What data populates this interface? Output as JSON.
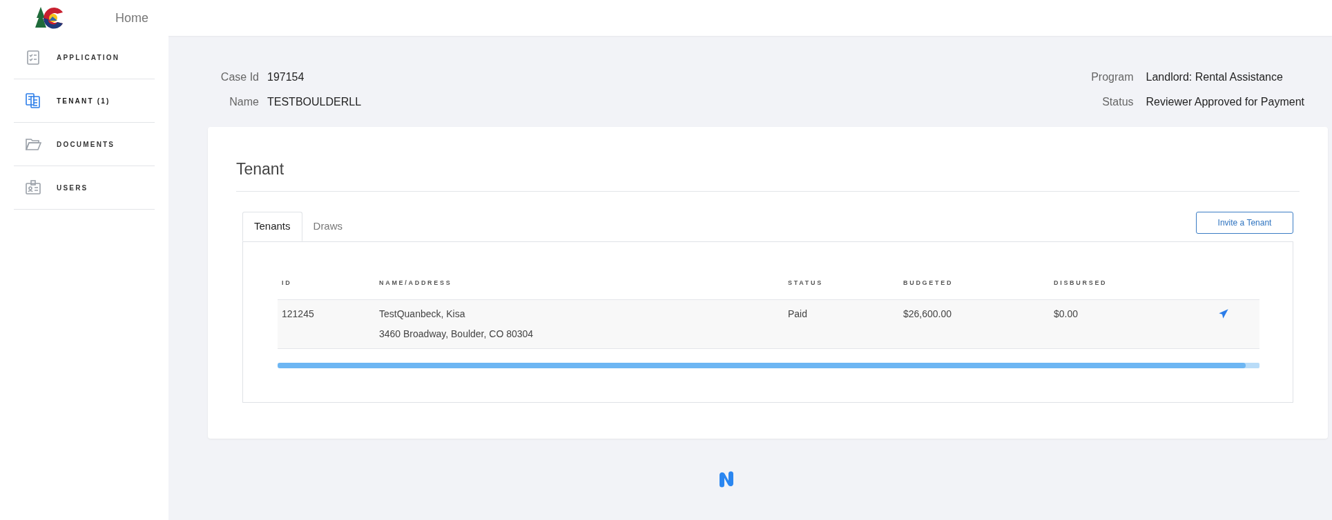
{
  "header": {
    "home_link": "Home"
  },
  "sidebar": {
    "items": [
      {
        "label": "APPLICATION",
        "selected": false
      },
      {
        "label": "TENANT (1)",
        "selected": true
      },
      {
        "label": "DOCUMENTS",
        "selected": false
      },
      {
        "label": "USERS",
        "selected": false
      }
    ]
  },
  "case_info": {
    "left": [
      {
        "label": "Case Id",
        "value": "197154"
      },
      {
        "label": "Name",
        "value": "TESTBOULDERLL"
      }
    ],
    "right": [
      {
        "label": "Program",
        "value": "Landlord: Rental Assistance"
      },
      {
        "label": "Status",
        "value": "Reviewer Approved for Payment"
      }
    ]
  },
  "card": {
    "title": "Tenant",
    "tabs": [
      {
        "label": "Tenants",
        "selected": true
      },
      {
        "label": "Draws",
        "selected": false
      }
    ],
    "invite_button": "Invite a Tenant",
    "table": {
      "columns": [
        "ID",
        "NAME/ADDRESS",
        "STATUS",
        "BUDGETED",
        "DISBURSED"
      ],
      "rows": [
        {
          "id": "121245",
          "name": "TestQuanbeck, Kisa",
          "address": "3460 Broadway, Boulder, CO 80304",
          "status": "Paid",
          "budgeted": "$26,600.00",
          "disbursed": "$0.00"
        }
      ]
    }
  }
}
